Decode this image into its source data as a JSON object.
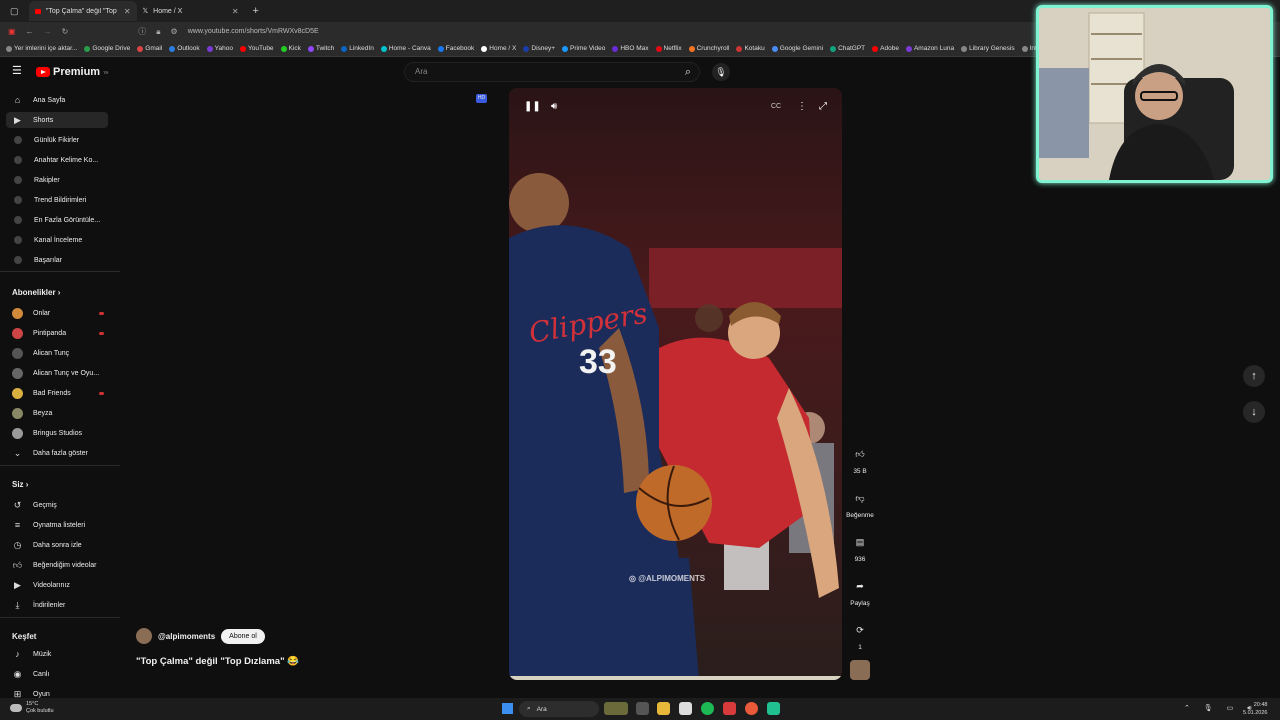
{
  "browser": {
    "tabs": [
      {
        "label": "\"Top Çalma\" değil \"Top Dı",
        "active": true
      },
      {
        "label": "Home / X",
        "active": false
      }
    ],
    "url": "www.youtube.com/shorts/VmRWXv8cD5E",
    "bookmarks": [
      "Yer imlerini içe aktar...",
      "Google Drive",
      "Gmail",
      "Outlook",
      "Yahoo",
      "YouTube",
      "Kick",
      "Twitch",
      "LinkedIn",
      "Home - Canva",
      "Facebook",
      "Home / X",
      "Disney+",
      "Prime Video",
      "HBO Max",
      "Netflix",
      "Crunchyroll",
      "Kotaku",
      "Google Gemini",
      "ChatGPT",
      "Adobe",
      "Amazon Luna",
      "Library Genesis",
      "Internet Archive"
    ]
  },
  "header": {
    "logo_text": "Premium",
    "logo_sup": "TR",
    "search_placeholder": "Ara"
  },
  "sidebar": {
    "main": [
      {
        "label": "Ana Sayfa",
        "icon": "home-icon"
      },
      {
        "label": "Shorts",
        "icon": "shorts-icon",
        "active": true
      }
    ],
    "sub": [
      "Günlük Fikirler",
      "Anahtar Kelime Ko...",
      "Rakipler",
      "Trend Bildirimleri",
      "En Fazla Görüntüle...",
      "Kanal İnceleme",
      "Başarılar"
    ],
    "subs_title": "Abonelikler",
    "subscriptions": [
      "Onlar",
      "Pintipanda",
      "Alican Tunç",
      "Alican Tunç ve Oyu...",
      "Bad Friends",
      "Beyza",
      "Bringus Studios"
    ],
    "show_more": "Daha fazla göster",
    "you_title": "Siz",
    "you_items": [
      "Geçmiş",
      "Oynatma listeleri",
      "Daha sonra izle",
      "Beğendiğim videolar",
      "Videolarınız",
      "İndirilenler"
    ],
    "explore_title": "Keşfet",
    "explore_items": [
      "Müzik",
      "Canlı",
      "Oyun"
    ]
  },
  "video": {
    "watermark": "@ALPIMOMENTS",
    "jersey_team": "Clippers",
    "jersey_number": "33",
    "channel": "@alpimoments",
    "subscribe_label": "Abone ol",
    "title": "\"Top Çalma\" değil \"Top Dızlama\" 😂"
  },
  "actions": {
    "likes": "35 B",
    "dislike_label": "Beğenme",
    "comments": "936",
    "share_label": "Paylaş",
    "remix": "1"
  },
  "taskbar": {
    "search_label": "Ara",
    "temp": "15°C",
    "weather": "Çok bulutlu",
    "time": "20:48",
    "date": "5.01.2026"
  }
}
